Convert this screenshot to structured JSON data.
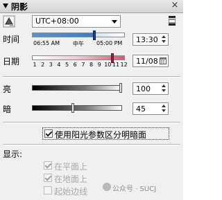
{
  "panel": {
    "title": "阴影"
  },
  "timezone": {
    "value": "UTC+08:00"
  },
  "time": {
    "label": "时间",
    "value": "13:30",
    "tick_labels": [
      "06:55 AM",
      "中午",
      "05:00 PM"
    ],
    "position_fraction": 0.67
  },
  "date": {
    "label": "日期",
    "value": "11/08",
    "months": [
      "1",
      "2",
      "3",
      "4",
      "5",
      "6",
      "7",
      "8",
      "9",
      "10",
      "11",
      "12"
    ],
    "position_month": 11
  },
  "light": {
    "label": "亮",
    "value": "100",
    "level": 1.0
  },
  "dark": {
    "label": "暗",
    "value": "45",
    "level": 0.45
  },
  "use_sun_checkbox": {
    "label": "使用阳光参数区分明暗面",
    "checked": true
  },
  "display": {
    "label": "显示:",
    "options": [
      {
        "label": "在平面上",
        "checked": true,
        "disabled": true
      },
      {
        "label": "在地面上",
        "checked": true,
        "disabled": true
      },
      {
        "label": "起始边线",
        "checked": false,
        "disabled": true
      }
    ]
  },
  "watermark": {
    "text": "公众号 · SUCJ"
  },
  "colors": {
    "time_thumb": "#1a3d8f",
    "date_gradient_end": "#d95870",
    "panel_bg": "#f0f0f0"
  }
}
